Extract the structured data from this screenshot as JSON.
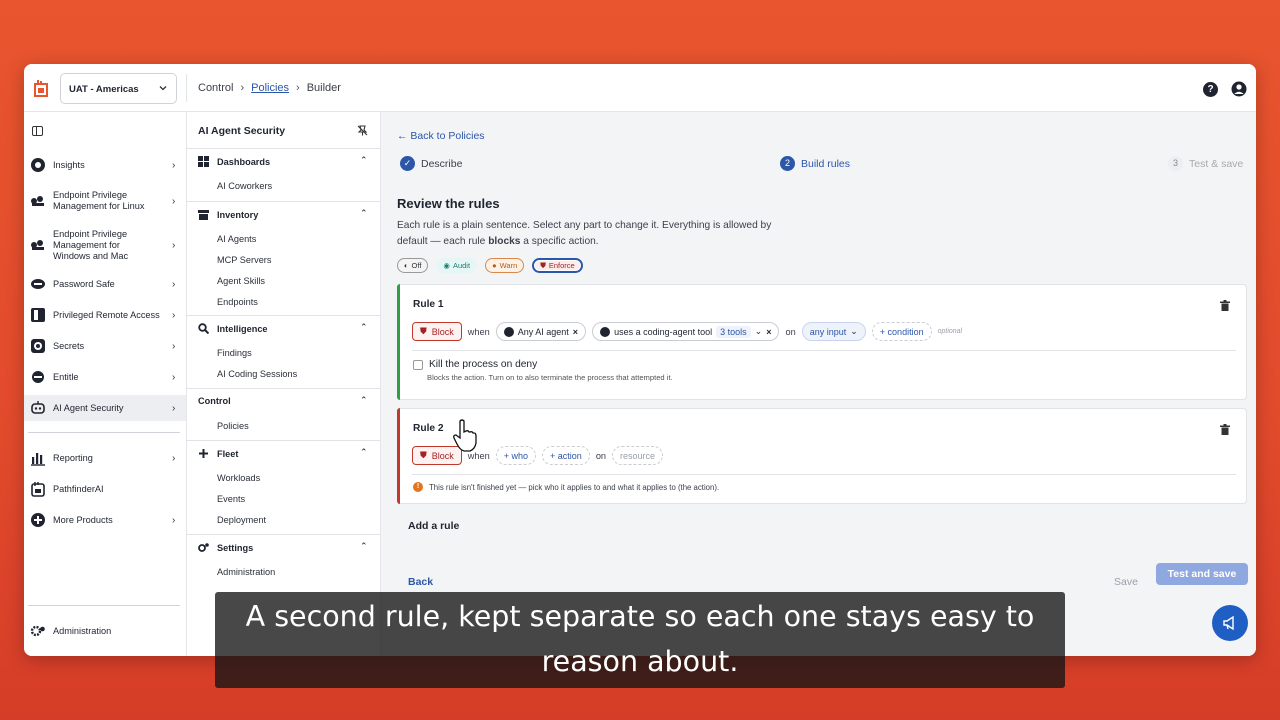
{
  "topbar": {
    "environment": "UAT - Americas",
    "breadcrumbs": [
      "Control",
      "Policies",
      "Builder"
    ],
    "help": "?"
  },
  "sidebar": {
    "items": [
      {
        "label": "Insights",
        "icon": "insights-icon"
      },
      {
        "label": "Endpoint Privilege Management for Linux",
        "icon": "epm-linux-icon"
      },
      {
        "label": "Endpoint Privilege Management for Windows and Mac",
        "icon": "epm-windows-icon"
      },
      {
        "label": "Password Safe",
        "icon": "password-safe-icon"
      },
      {
        "label": "Privileged Remote Access",
        "icon": "remote-access-icon"
      },
      {
        "label": "Secrets",
        "icon": "secrets-icon"
      },
      {
        "label": "Entitle",
        "icon": "entitle-icon"
      },
      {
        "label": "AI Agent Security",
        "icon": "ai-agent-icon"
      },
      {
        "label": "Reporting",
        "icon": "reporting-icon"
      },
      {
        "label": "PathfinderAI",
        "icon": "pathfinder-icon"
      },
      {
        "label": "More Products",
        "icon": "plus-circle-icon"
      }
    ],
    "admin": "Administration"
  },
  "nav2": {
    "title": "AI Agent Security",
    "groups": [
      {
        "label": "Dashboards",
        "items": [
          "AI Coworkers"
        ]
      },
      {
        "label": "Inventory",
        "items": [
          "AI Agents",
          "MCP Servers",
          "Agent Skills",
          "Endpoints"
        ]
      },
      {
        "label": "Intelligence",
        "items": [
          "Findings",
          "AI Coding Sessions"
        ]
      },
      {
        "label": "Control",
        "items": [
          "Policies"
        ]
      },
      {
        "label": "Fleet",
        "items": [
          "Workloads",
          "Events",
          "Deployment"
        ]
      },
      {
        "label": "Settings",
        "items": [
          "Administration"
        ]
      }
    ]
  },
  "main": {
    "back": "← Back to Policies",
    "steps": [
      {
        "num": "✓",
        "label": "Describe"
      },
      {
        "num": "2",
        "label": "Build rules"
      },
      {
        "num": "3",
        "label": "Test & save"
      }
    ],
    "title": "Review the rules",
    "desc1": "Each rule is a plain sentence. Select any part to change it. Everything is allowed by",
    "desc2a": "default — each rule ",
    "desc2b": "blocks",
    "desc2c": " a specific action.",
    "modes": [
      "Off",
      "Audit",
      "Warn",
      "Enforce"
    ],
    "rule1": {
      "title": "Rule 1",
      "action": "Block",
      "when": "when",
      "who": "Any AI agent",
      "tool": "uses a coding-agent tool",
      "tools": "3 tools",
      "on": "on",
      "input": "any input",
      "condition": "+ condition",
      "optional": "optional",
      "kill": "Kill the process on deny",
      "kill_desc": "Blocks the action. Turn on to also terminate the process that attempted it."
    },
    "rule2": {
      "title": "Rule 2",
      "action": "Block",
      "when": "when",
      "who": "+ who",
      "act": "+ action",
      "on": "on",
      "resource": "resource",
      "warning": "This rule isn't finished yet — pick who it applies to and what it applies to (the action)."
    },
    "add_rule": "Add a rule",
    "back_btn": "Back",
    "save": "Save",
    "test_save": "Test and save"
  },
  "caption": {
    "line1": "A second rule, kept separate so each one stays easy to",
    "line2": "reason about."
  }
}
